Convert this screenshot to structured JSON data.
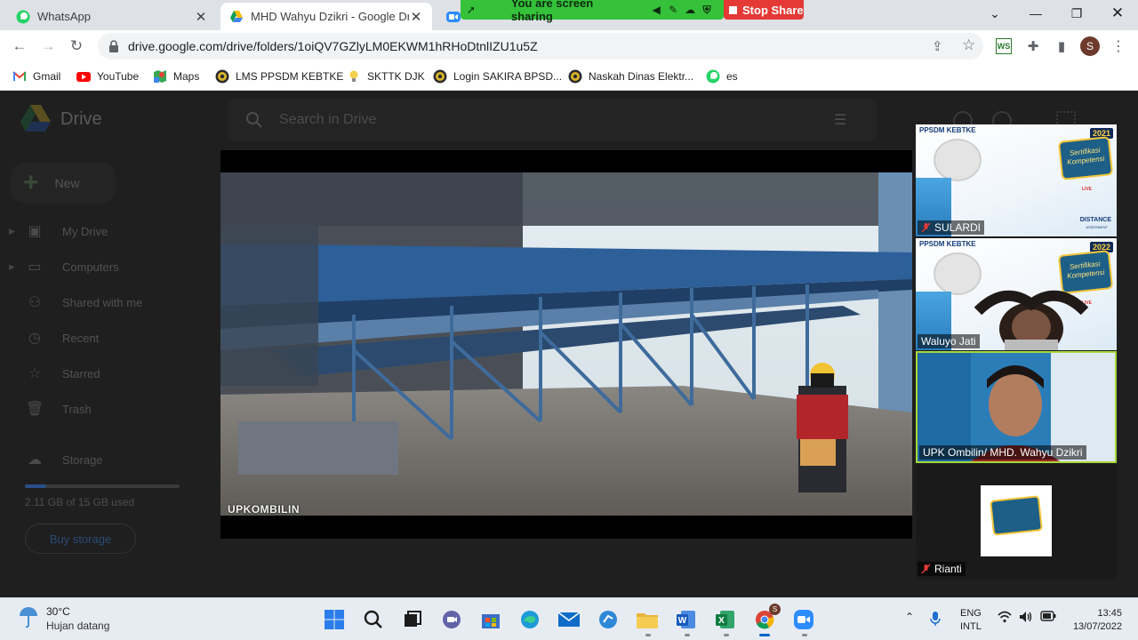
{
  "browser": {
    "tabs": [
      {
        "title": "WhatsApp",
        "icon": "whatsapp-icon"
      },
      {
        "title": "MHD Wahyu Dzikri - Google Drive",
        "icon": "google-drive-icon"
      }
    ],
    "url": "drive.google.com/drive/folders/1oiQV7GZlyLM0EKWM1hRHoDtnlIZU1u5Z",
    "profile_initial": "S",
    "bookmarks": [
      {
        "label": "Gmail",
        "icon": "gmail-icon"
      },
      {
        "label": "YouTube",
        "icon": "youtube-icon"
      },
      {
        "label": "Maps",
        "icon": "maps-icon"
      },
      {
        "label": "LMS PPSDM KEBTKE",
        "icon": "esdm-logo-icon"
      },
      {
        "label": "SKTTK DJK",
        "icon": "bulb-icon"
      },
      {
        "label": "Login SAKIRA BPSD...",
        "icon": "esdm-logo-icon"
      },
      {
        "label": "Naskah Dinas Elektr...",
        "icon": "esdm-logo-icon"
      },
      {
        "label": "es",
        "icon": "whatsapp-icon"
      }
    ]
  },
  "screen_share": {
    "status": "You are screen sharing",
    "stop_label": "Stop Share",
    "color": "#35c13a",
    "stop_color": "#e53935"
  },
  "drive": {
    "app_name": "Drive",
    "search_placeholder": "Search in Drive",
    "new_label": "New",
    "nav": [
      {
        "label": "My Drive",
        "icon": "my-drive-icon"
      },
      {
        "label": "Computers",
        "icon": "computers-icon"
      },
      {
        "label": "Shared with me",
        "icon": "shared-icon"
      },
      {
        "label": "Recent",
        "icon": "clock-icon"
      },
      {
        "label": "Starred",
        "icon": "star-icon"
      },
      {
        "label": "Trash",
        "icon": "trash-icon"
      }
    ],
    "storage_label": "Storage",
    "storage_used": "2.11 GB of 15 GB used",
    "storage_fraction": 0.14,
    "buy_label": "Buy storage"
  },
  "video": {
    "watermark": "UPKOMBILIN"
  },
  "participants": [
    {
      "name": "SULARDI",
      "muted": true,
      "head": "PPSDM KEBTKE",
      "year": "2021",
      "badge": "Sertifikasi Kompetensi",
      "live": "LIVE",
      "footer1": "DISTANCE",
      "footer2": "ASSESMENT"
    },
    {
      "name": "Waluyo Jati",
      "muted": false,
      "head": "PPSDM KEBTKE",
      "year": "2022",
      "badge": "Sertifikasi Kompetensi",
      "live": "LIVE"
    },
    {
      "name": "UPK Ombilin/ MHD. Wahyu Dzikri",
      "muted": false,
      "speaking": true
    },
    {
      "name": "Rianti",
      "muted": true
    }
  ],
  "taskbar": {
    "weather_temp": "30°C",
    "weather_desc": "Hujan datang",
    "lang_top": "ENG",
    "lang_bottom": "INTL",
    "time": "13:45",
    "date": "13/07/2022",
    "chrome_badge": "S"
  }
}
